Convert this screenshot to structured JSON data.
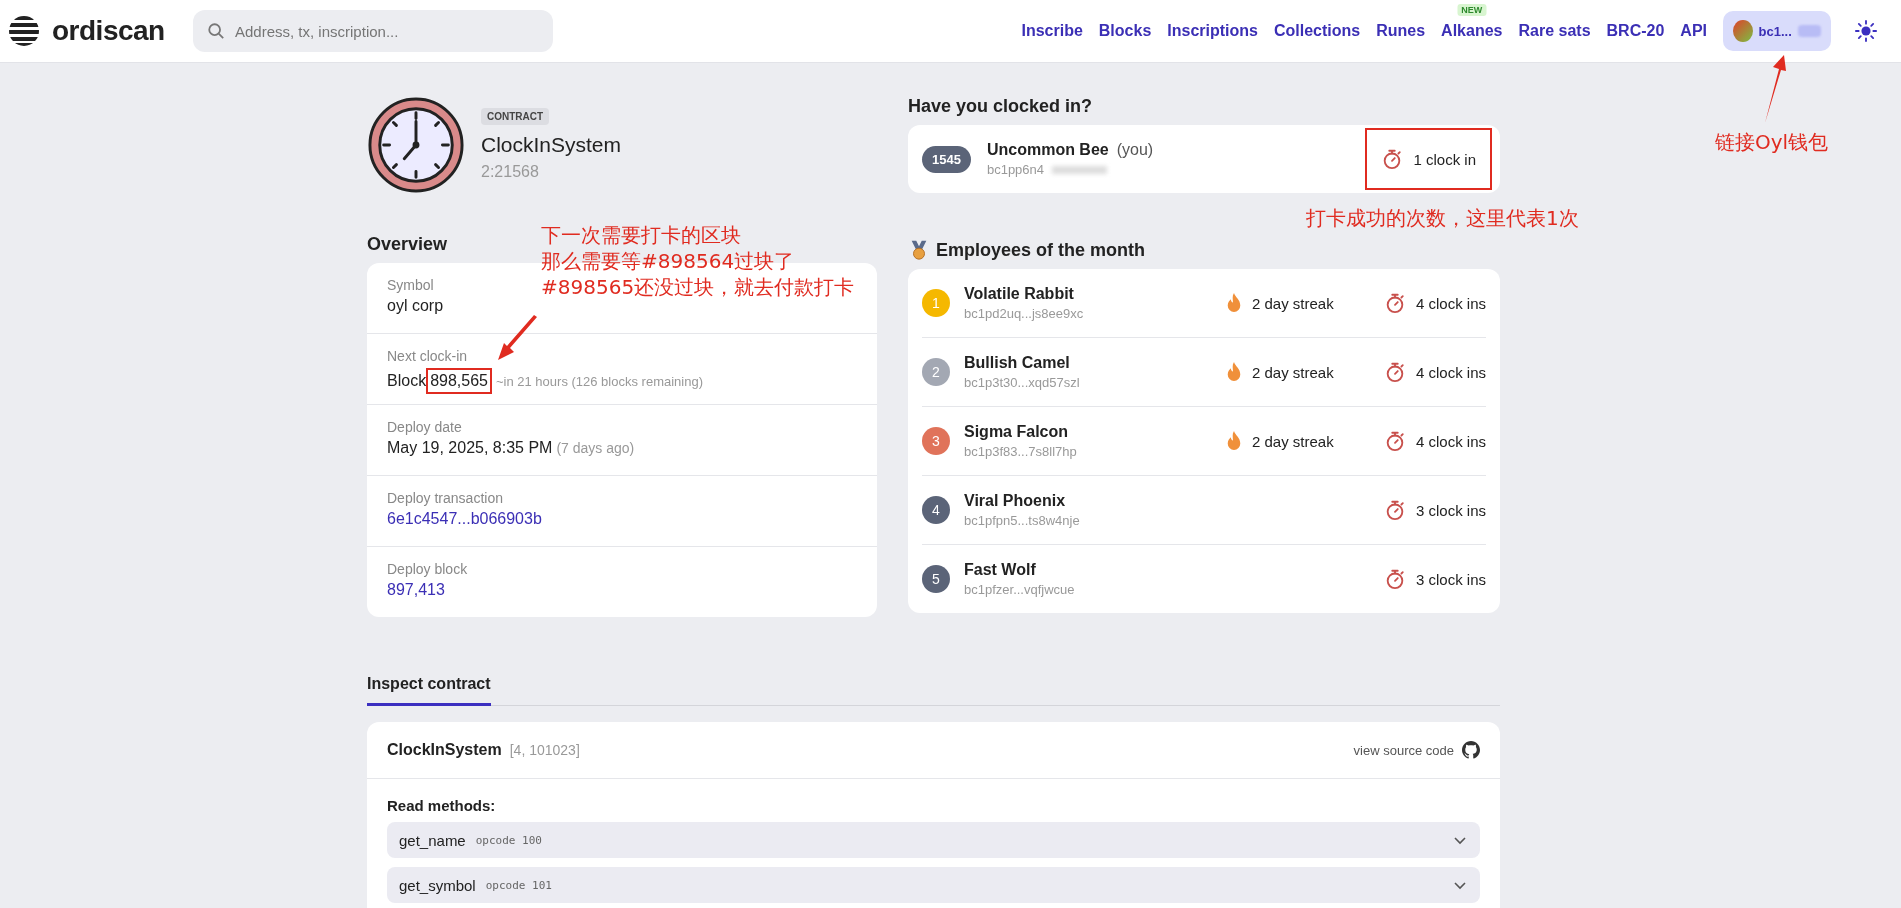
{
  "header": {
    "logo": "ordiscan",
    "search": {
      "placeholder": "Address, tx, inscription..."
    },
    "nav": [
      {
        "label": "Inscribe"
      },
      {
        "label": "Blocks"
      },
      {
        "label": "Inscriptions"
      },
      {
        "label": "Collections"
      },
      {
        "label": "Runes"
      },
      {
        "label": "Alkanes",
        "badge": "NEW"
      },
      {
        "label": "Rare sats"
      },
      {
        "label": "BRC-20"
      },
      {
        "label": "API"
      }
    ],
    "wallet": {
      "address": "bc1..."
    }
  },
  "contract": {
    "badge": "CONTRACT",
    "name": "ClockInSystem",
    "id": "2:21568"
  },
  "overview": {
    "title": "Overview",
    "fields": [
      {
        "kind": "text",
        "label": "Symbol",
        "value": "oyl corp"
      },
      {
        "kind": "block",
        "label": "Next clock-in",
        "prefix": "Block",
        "value": "898,565",
        "note": "~in 21 hours (126 blocks remaining)"
      },
      {
        "kind": "text",
        "label": "Deploy date",
        "value": "May 19, 2025, 8:35 PM",
        "note": "(7 days ago)"
      },
      {
        "kind": "link",
        "label": "Deploy transaction",
        "value": "6e1c4547...b066903b"
      },
      {
        "kind": "link",
        "label": "Deploy block",
        "value": "897,413"
      }
    ]
  },
  "clocked_in": {
    "title": "Have you clocked in?",
    "rank": "1545",
    "name": "Uncommon Bee",
    "suffix": "(you)",
    "address": "bc1pp6n4",
    "count": "1 clock in"
  },
  "employees": {
    "title": "Employees of the month",
    "rows": [
      {
        "rank": "1",
        "color": "#f5b800",
        "name": "Volatile Rabbit",
        "address": "bc1pd2uq...js8ee9xc",
        "streak": "2 day streak",
        "clock_ins": "4 clock ins"
      },
      {
        "rank": "2",
        "color": "#a3a8b3",
        "name": "Bullish Camel",
        "address": "bc1p3t30...xqd57szl",
        "streak": "2 day streak",
        "clock_ins": "4 clock ins"
      },
      {
        "rank": "3",
        "color": "#e0735a",
        "name": "Sigma Falcon",
        "address": "bc1p3f83...7s8ll7hp",
        "streak": "2 day streak",
        "clock_ins": "4 clock ins"
      },
      {
        "rank": "4",
        "color": "#5b6478",
        "name": "Viral Phoenix",
        "address": "bc1pfpn5...ts8w4nje",
        "clock_ins": "3 clock ins"
      },
      {
        "rank": "5",
        "color": "#5b6478",
        "name": "Fast Wolf",
        "address": "bc1pfzer...vqfjwcue",
        "clock_ins": "3 clock ins"
      }
    ]
  },
  "inspect": {
    "tabs": [
      {
        "label": "Inspect contract",
        "selected": true
      }
    ],
    "name": "ClockInSystem",
    "ids": "[4, 101023]",
    "source_link": "view source code",
    "methods_title": "Read methods:",
    "methods": [
      {
        "name": "get_name",
        "opcode_label": "opcode",
        "opcode": "100"
      },
      {
        "name": "get_symbol",
        "opcode_label": "opcode",
        "opcode": "101"
      }
    ]
  },
  "annotations": [
    {
      "kind": "block_note",
      "lines": [
        "下一次需要打卡的区块",
        "那么需要等#898564过块了",
        "#898565还没过块，就去付款打卡"
      ]
    },
    {
      "kind": "count_note",
      "lines": [
        "打卡成功的次数，这里代表1次"
      ]
    },
    {
      "kind": "wallet_note",
      "lines": [
        "链接Oyl钱包"
      ]
    }
  ]
}
